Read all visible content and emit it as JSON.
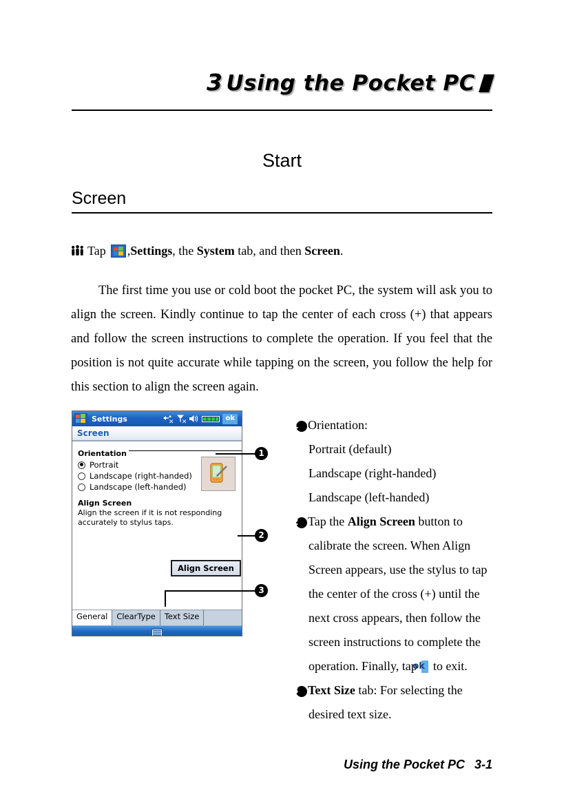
{
  "chapter": {
    "number": "3",
    "title": "Using the Pocket PC",
    "slash_icon": "slash-mark"
  },
  "start_title": "Start",
  "section": {
    "heading": "Screen"
  },
  "tap_line": {
    "people_icon": "group-of-people-icon",
    "tap_word": "Tap",
    "start_icon": "windows-start-flag-icon",
    "comma": ",",
    "settings": "Settings",
    "mid_1": ", the ",
    "system": "System",
    "mid_2": " tab, and then ",
    "screen": "Screen",
    "period": "."
  },
  "intro_paragraph": "The first time you use or cold boot the pocket PC, the system will ask you to align the screen. Kindly continue to tap the center of each cross (+) that appears and follow the screen instructions to complete the operation. If you feel that the position is not quite accurate while tapping on the screen, you follow the help for this section to align the screen again.",
  "pda": {
    "title": "Settings",
    "start_icon": "windows-start-flag-icon",
    "status_icons": [
      "connectivity-disconnected-icon",
      "signal-no-service-icon",
      "speaker-volume-icon",
      "battery-meter-icon"
    ],
    "ok_button": "ok",
    "subtitle": "Screen",
    "orientation_group_label": "Orientation",
    "orientation_options": [
      {
        "label": "Portrait",
        "selected": true
      },
      {
        "label": "Landscape (right-handed)",
        "selected": false
      },
      {
        "label": "Landscape (left-handed)",
        "selected": false
      }
    ],
    "device_thumb_icon": "pda-with-stylus-icon",
    "align_heading": "Align Screen",
    "align_description": "Align the screen if it is not responding accurately to stylus taps.",
    "align_button": "Align Screen",
    "tabs": [
      {
        "label": "General",
        "active": true
      },
      {
        "label": "ClearType",
        "active": false
      },
      {
        "label": "Text Size",
        "active": false
      }
    ],
    "sip_icon": "keyboard-icon"
  },
  "callouts": {
    "badge_1": "❶",
    "badge_2": "❷",
    "badge_3": "❸",
    "num_1": "1",
    "num_2": "2",
    "num_3": "3"
  },
  "list": {
    "item1": {
      "heading": "Orientation:",
      "options": [
        "Portrait (default)",
        "Landscape (right-handed)",
        "Landscape (left-handed)"
      ]
    },
    "item2": {
      "seg_a": "Tap the ",
      "seg_b_bold": "Align Screen",
      "seg_c": " button to calibrate the screen. When Align Screen appears, use the stylus to tap the center of the cross (+) until the next cross appears, then follow the screen instructions to complete the operation. Finally, tap ",
      "ok_badge": "ok",
      "seg_d": " to exit."
    },
    "item3": {
      "seg_a_bold": "Text Size",
      "seg_b": " tab: For selecting the desired text size."
    }
  },
  "footer": {
    "title": "Using the Pocket PC",
    "page": "3-1"
  }
}
